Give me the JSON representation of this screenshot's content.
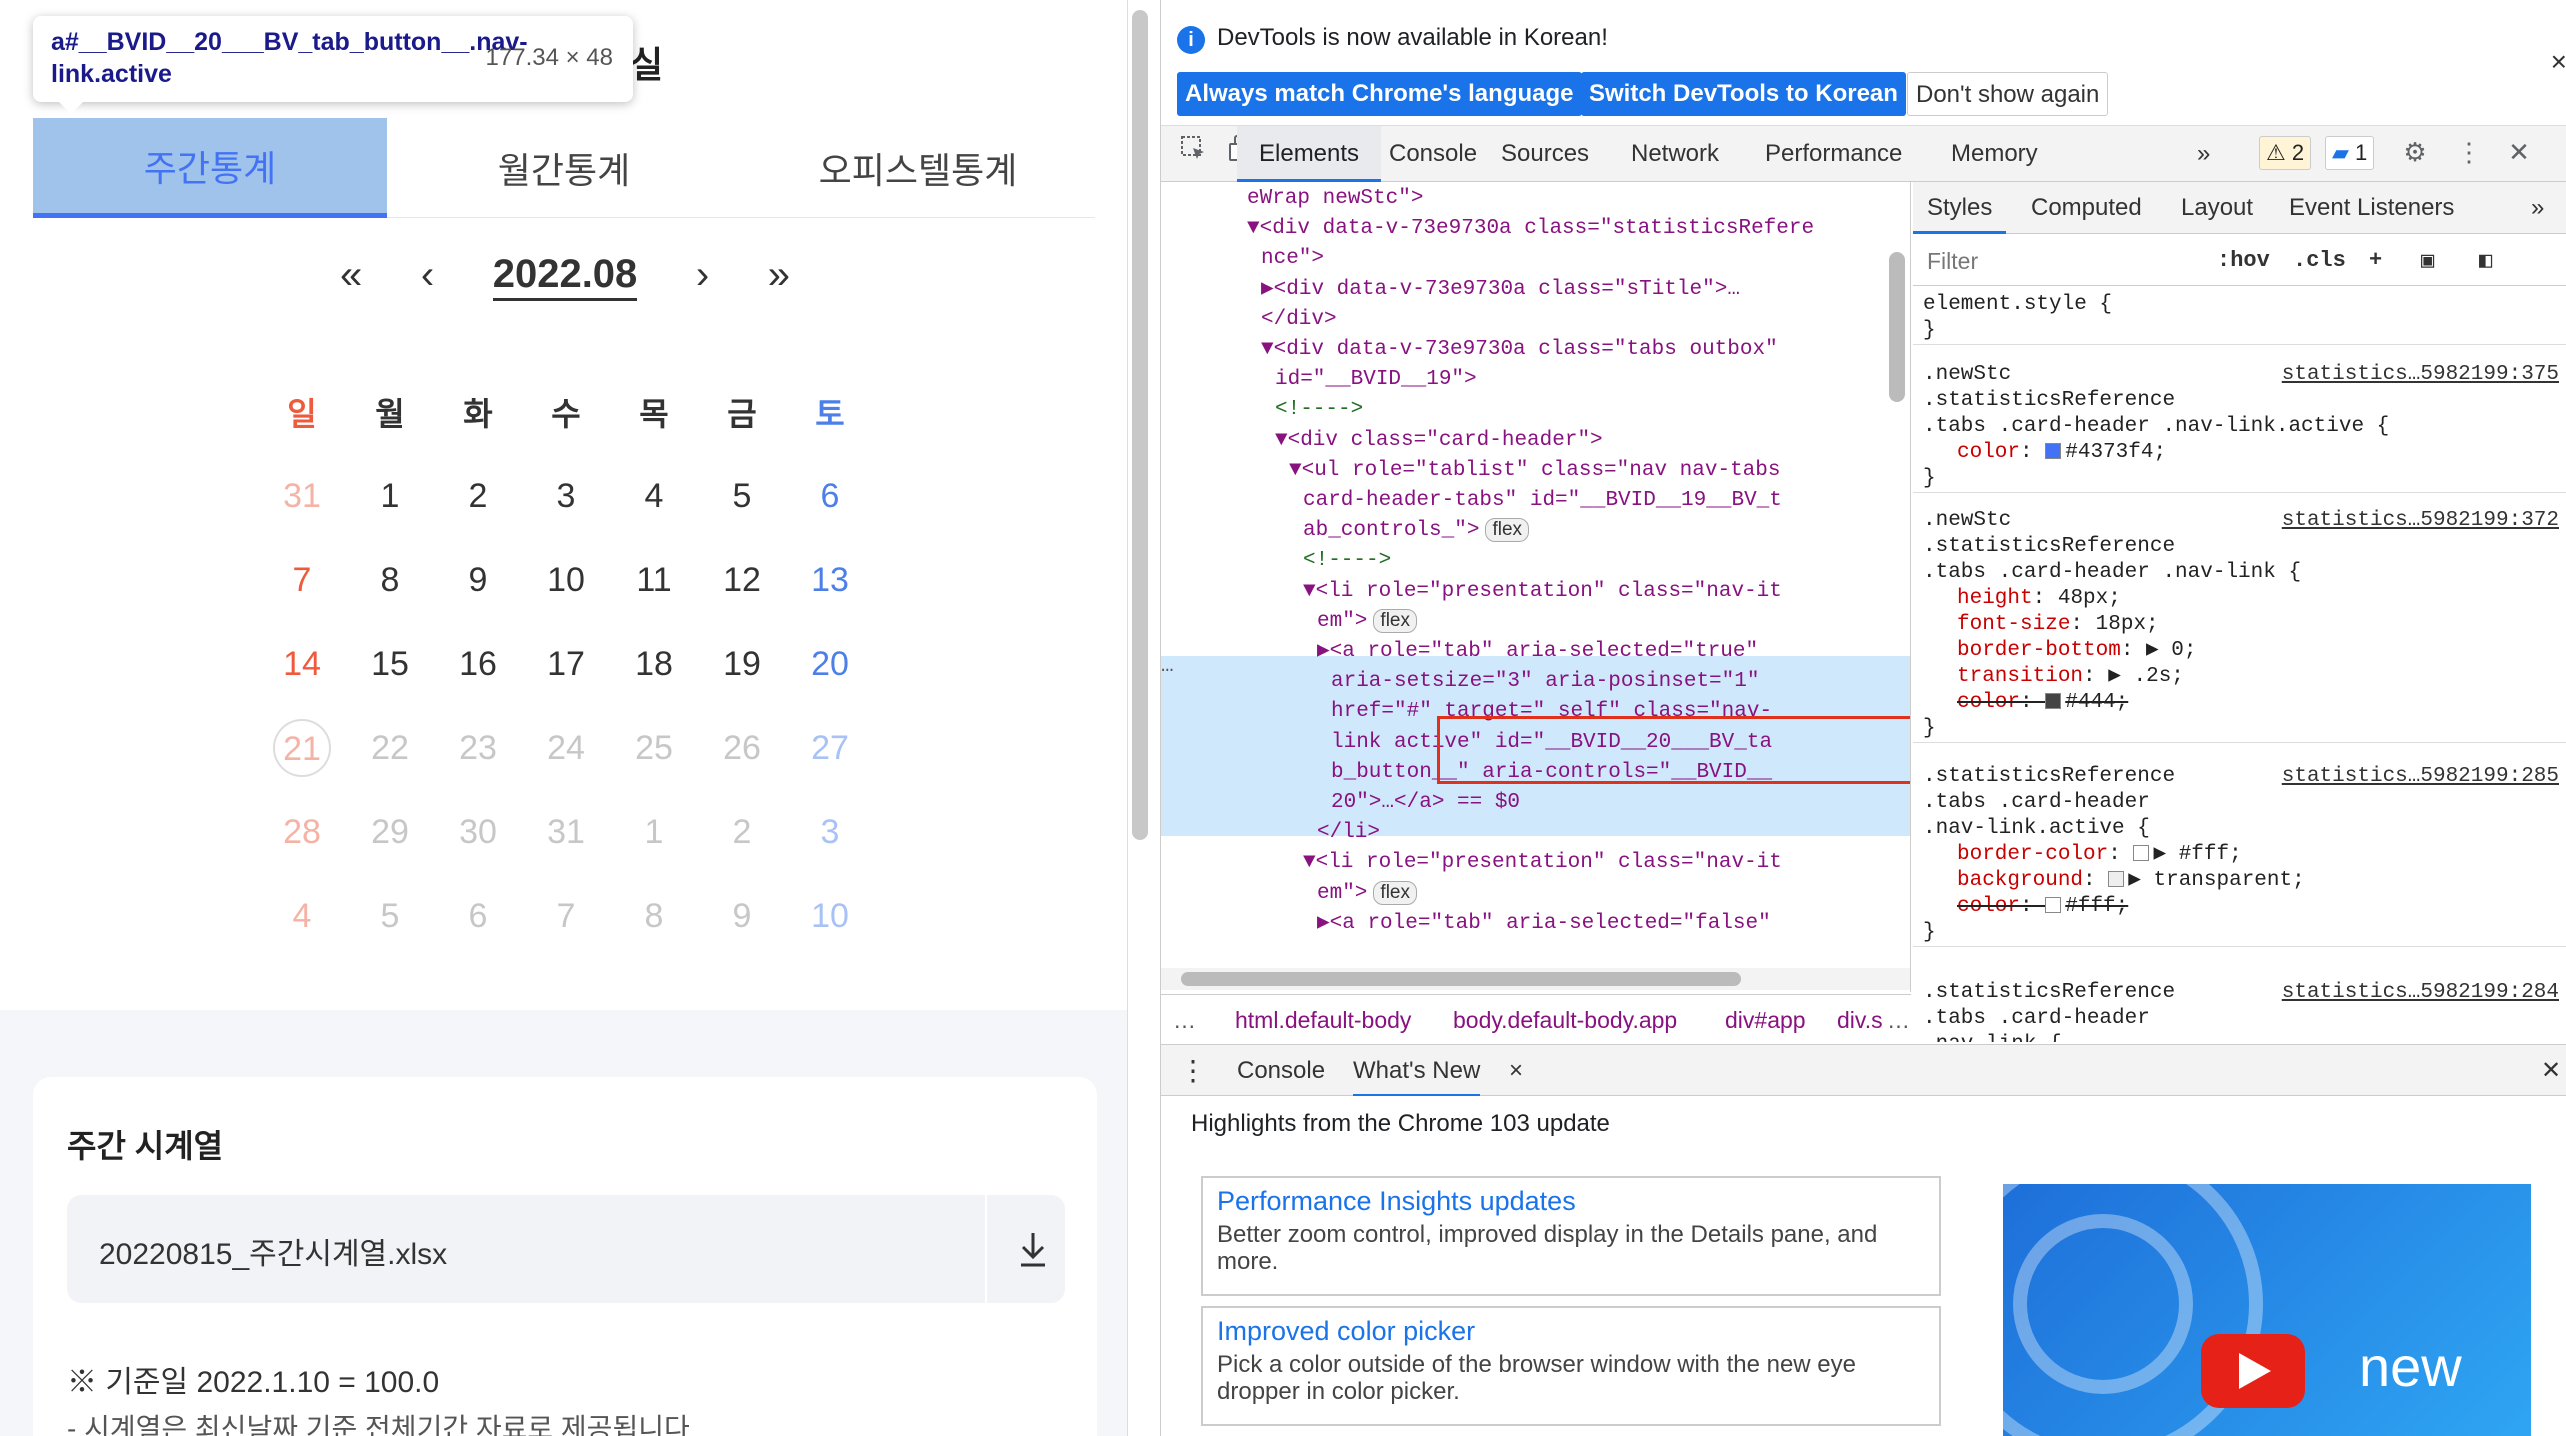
{
  "page": {
    "tooltip": {
      "selector": "a#__BVID__20___BV_tab_button__.nav-link.active",
      "size": "177.34 × 48"
    },
    "behind_title_fragment": "실",
    "tabs": [
      {
        "label": "주간통계",
        "active": true
      },
      {
        "label": "월간통계",
        "active": false
      },
      {
        "label": "오피스텔통계",
        "active": false
      }
    ],
    "month_nav": {
      "first": "«",
      "prev": "‹",
      "current": "2022.08",
      "next": "›",
      "last": "»"
    },
    "weekdays": [
      "일",
      "월",
      "화",
      "수",
      "목",
      "금",
      "토"
    ],
    "calendar_rows": [
      [
        {
          "d": "31",
          "dim": true
        },
        {
          "d": "1"
        },
        {
          "d": "2"
        },
        {
          "d": "3"
        },
        {
          "d": "4"
        },
        {
          "d": "5"
        },
        {
          "d": "6"
        }
      ],
      [
        {
          "d": "7"
        },
        {
          "d": "8"
        },
        {
          "d": "9"
        },
        {
          "d": "10"
        },
        {
          "d": "11"
        },
        {
          "d": "12"
        },
        {
          "d": "13"
        }
      ],
      [
        {
          "d": "14"
        },
        {
          "d": "15"
        },
        {
          "d": "16"
        },
        {
          "d": "17"
        },
        {
          "d": "18"
        },
        {
          "d": "19"
        },
        {
          "d": "20"
        }
      ],
      [
        {
          "d": "21",
          "dim": true,
          "today": true
        },
        {
          "d": "22",
          "dim": true
        },
        {
          "d": "23",
          "dim": true
        },
        {
          "d": "24",
          "dim": true
        },
        {
          "d": "25",
          "dim": true
        },
        {
          "d": "26",
          "dim": true
        },
        {
          "d": "27",
          "dim": true
        }
      ],
      [
        {
          "d": "28",
          "dim": true
        },
        {
          "d": "29",
          "dim": true
        },
        {
          "d": "30",
          "dim": true
        },
        {
          "d": "31",
          "dim": true
        },
        {
          "d": "1",
          "dim": true
        },
        {
          "d": "2",
          "dim": true
        },
        {
          "d": "3",
          "dim": true
        }
      ],
      [
        {
          "d": "4",
          "dim": true
        },
        {
          "d": "5",
          "dim": true
        },
        {
          "d": "6",
          "dim": true
        },
        {
          "d": "7",
          "dim": true
        },
        {
          "d": "8",
          "dim": true
        },
        {
          "d": "9",
          "dim": true
        },
        {
          "d": "10",
          "dim": true
        }
      ]
    ],
    "card": {
      "title": "주간 시계열",
      "file_name": "20220815_주간시계열.xlsx",
      "note1": "※  기준일  2022.1.10 = 100.0",
      "note2": "- 시계열은 최신날짜 기준 전체기간 자료로 제공됩니다"
    }
  },
  "devtools": {
    "lang_bar": {
      "message": "DevTools is now available in Korean!",
      "btn_match": "Always match Chrome's language",
      "btn_switch": "Switch DevTools to Korean",
      "btn_dismiss": "Don't show again",
      "close": "×"
    },
    "tabs": [
      "Elements",
      "Console",
      "Sources",
      "Network",
      "Performance",
      "Memory"
    ],
    "more": "»",
    "warn_count": "2",
    "msg_count": "1",
    "elements_lines": [
      {
        "t": "eWrap newStc\">",
        "indent": 0
      },
      {
        "t": "▼<div data-v-73e9730a class=\"statisticsRefere",
        "indent": 0
      },
      {
        "t": "nce\">",
        "indent": 1
      },
      {
        "t": "▶<div data-v-73e9730a class=\"sTitle\">…",
        "indent": 1
      },
      {
        "t": "</div>",
        "indent": 1
      },
      {
        "t": "▼<div data-v-73e9730a class=\"tabs outbox\"",
        "indent": 1
      },
      {
        "t": "id=\"__BVID__19\">",
        "indent": 2
      },
      {
        "t": "<!---->",
        "indent": 2
      },
      {
        "t": "▼<div class=\"card-header\">",
        "indent": 2
      },
      {
        "t": "▼<ul role=\"tablist\" class=\"nav nav-tabs",
        "indent": 3
      },
      {
        "t": "card-header-tabs\" id=\"__BVID__19__BV_t",
        "indent": 4
      },
      {
        "t": "ab_controls_\">",
        "indent": 4,
        "pill": "flex"
      },
      {
        "t": "<!---->",
        "indent": 4
      },
      {
        "t": "▼<li role=\"presentation\" class=\"nav-it",
        "indent": 4
      },
      {
        "t": "em\">",
        "indent": 5,
        "pill": "flex"
      },
      {
        "t": "▶<a role=\"tab\" aria-selected=\"true\"",
        "indent": 5
      },
      {
        "t": "aria-setsize=\"3\" aria-posinset=\"1\"",
        "indent": 6
      },
      {
        "t": "href=\"#\" target=\"_self\" class=\"nav-",
        "indent": 6
      },
      {
        "t": "link active\" id=\"__BVID__20___BV_ta",
        "indent": 6
      },
      {
        "t": "b_button__\" aria-controls=\"__BVID__",
        "indent": 6
      },
      {
        "t": "20\">…</a> == $0",
        "indent": 6
      },
      {
        "t": "</li>",
        "indent": 5
      },
      {
        "t": "▼<li role=\"presentation\" class=\"nav-it",
        "indent": 4
      },
      {
        "t": "em\">",
        "indent": 5,
        "pill": "flex"
      },
      {
        "t": "▶<a role=\"tab\" aria-selected=\"false\"",
        "indent": 5
      }
    ],
    "breadcrumbs": [
      "html.default-body",
      "body.default-body.app",
      "div#app",
      "div.s"
    ],
    "breadcrumb_more": "…",
    "styles_tabs": [
      "Styles",
      "Computed",
      "Layout",
      "Event Listeners"
    ],
    "filter_placeholder": "Filter",
    "hov": ":hov",
    "cls": ".cls",
    "rules": [
      {
        "selector": "element.style {",
        "src": "",
        "props": [],
        "close": "}"
      },
      {
        "selector": ".newStc\n.statisticsReference\n.tabs .card-header .nav-link.active {",
        "src": "statistics…5982199:375",
        "props": [
          {
            "n": "color",
            "v": "#4373f4;",
            "swatch": "#4373f4"
          }
        ],
        "close": "}"
      },
      {
        "selector": ".newStc\n.statisticsReference\n.tabs .card-header .nav-link {",
        "src": "statistics…5982199:372",
        "props": [
          {
            "n": "height",
            "v": "48px;"
          },
          {
            "n": "font-size",
            "v": "18px;"
          },
          {
            "n": "border-bottom",
            "v": "▶ 0;"
          },
          {
            "n": "transition",
            "v": "▶ .2s;"
          },
          {
            "n": "color",
            "v": "#444;",
            "swatch": "#444444",
            "strike": true
          }
        ],
        "close": "}"
      },
      {
        "selector": ".statisticsReference\n.tabs .card-header\n.nav-link.active {",
        "src": "statistics…5982199:285",
        "props": [
          {
            "n": "border-color",
            "v": "▶ #fff;",
            "swatch": "#ffffff"
          },
          {
            "n": "background",
            "v": "▶ transparent;",
            "swatch": "#eeeeee"
          },
          {
            "n": "color",
            "v": "#fff;",
            "swatch": "#ffffff",
            "strike": true
          }
        ],
        "close": "}"
      },
      {
        "selector": ".statisticsReference\n.tabs .card-header\n.nav-link {",
        "src": "statistics…5982199:284",
        "props": [],
        "close": ""
      }
    ],
    "drawer": {
      "tab_console": "Console",
      "tab_whatsnew": "What's New",
      "close_tab": "×",
      "highlights": "Highlights from the Chrome 103 update",
      "features": [
        {
          "title": "Performance Insights updates",
          "desc": "Better zoom control, improved display in the Details pane, and more."
        },
        {
          "title": "Improved color picker",
          "desc": "Pick a color outside of the browser window with the new eye dropper in color picker."
        }
      ],
      "video_word": "new"
    }
  }
}
